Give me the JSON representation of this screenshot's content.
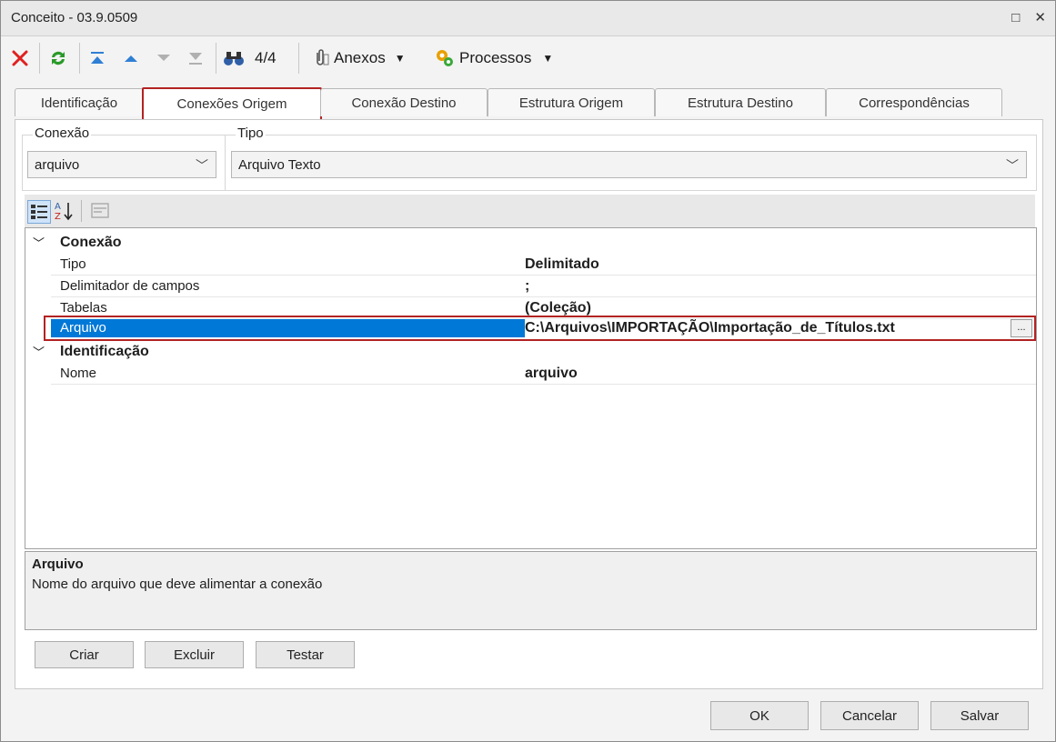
{
  "window": {
    "title": "Conceito - 03.9.0509",
    "restore_icon": "□",
    "close_icon": "✕"
  },
  "toolbar": {
    "record_counter": "4/4",
    "attachments_label": "Anexos",
    "processes_label": "Processos"
  },
  "tabs": [
    {
      "label": "Identificação"
    },
    {
      "label": "Conexões Origem"
    },
    {
      "label": "Conexão Destino"
    },
    {
      "label": "Estrutura Origem"
    },
    {
      "label": "Estrutura Destino"
    },
    {
      "label": "Correspondências"
    }
  ],
  "form": {
    "connection_label": "Conexão",
    "connection_value": "arquivo",
    "type_label": "Tipo",
    "type_value": "Arquivo Texto"
  },
  "property_grid": {
    "categories": [
      {
        "name": "Conexão",
        "rows": [
          {
            "name": "Tipo",
            "value": "Delimitado"
          },
          {
            "name": "Delimitador de campos",
            "value": ";"
          },
          {
            "name": "Tabelas",
            "value": "(Coleção)"
          },
          {
            "name": "Arquivo",
            "value": "C:\\Arquivos\\IMPORTAÇÃO\\Importação_de_Títulos.txt"
          }
        ]
      },
      {
        "name": "Identificação",
        "rows": [
          {
            "name": "Nome",
            "value": "arquivo"
          }
        ]
      }
    ],
    "ellipsis_label": "..."
  },
  "description": {
    "title": "Arquivo",
    "text": "Nome do arquivo que deve alimentar a conexão"
  },
  "actions": {
    "create": "Criar",
    "delete": "Excluir",
    "test": "Testar"
  },
  "footer": {
    "ok": "OK",
    "cancel": "Cancelar",
    "save": "Salvar"
  },
  "colors": {
    "selection": "#0078d7",
    "highlight_border": "#b22222"
  }
}
